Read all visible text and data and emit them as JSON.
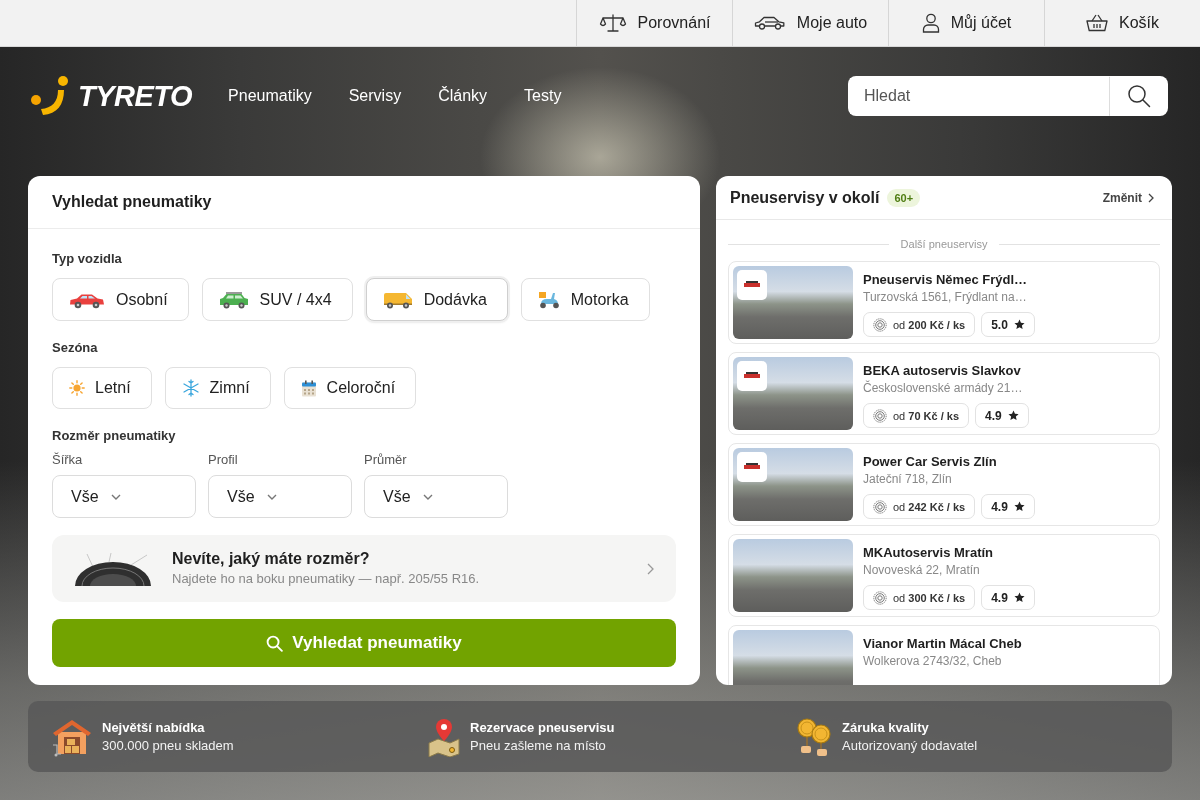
{
  "top_bar": {
    "links": [
      {
        "kind": "compare",
        "label": "Porovnání"
      },
      {
        "kind": "car",
        "label": "Moje auto"
      },
      {
        "kind": "account",
        "label": "Můj účet"
      },
      {
        "kind": "cart",
        "label": "Košík"
      }
    ]
  },
  "header": {
    "logo": "TYRETO",
    "nav": [
      "Pneumatiky",
      "Servisy",
      "Články",
      "Testy"
    ],
    "search": {
      "placeholder": "Hledat"
    }
  },
  "search_panel": {
    "title": "Vyhledat pneumatiky",
    "vehicle_type": {
      "label": "Typ vozidla",
      "options": [
        {
          "kind": "car",
          "label": "Osobní",
          "selected": false
        },
        {
          "kind": "suv",
          "label": "SUV / 4x4",
          "selected": false
        },
        {
          "kind": "van",
          "label": "Dodávka",
          "selected": true
        },
        {
          "kind": "scooter",
          "label": "Motorka",
          "selected": false
        }
      ]
    },
    "season": {
      "label": "Sezóna",
      "options": [
        {
          "kind": "summer",
          "label": "Letní",
          "selected": false
        },
        {
          "kind": "winter",
          "label": "Zimní",
          "selected": false
        },
        {
          "kind": "all_season",
          "label": "Celoroční",
          "selected": false
        }
      ]
    },
    "tire_size": {
      "label": "Rozměr pneumatiky",
      "fields": [
        {
          "label": "Šířka",
          "value": "Vše"
        },
        {
          "label": "Profil",
          "value": "Vše"
        },
        {
          "label": "Průměr",
          "value": "Vše"
        }
      ]
    },
    "size_hint": {
      "title": "Nevíte, jaký máte rozměr?",
      "text": "Najdete ho na boku pneumatiky — např. 205/55 R16."
    },
    "submit": "Vyhledat pneumatiky"
  },
  "services": {
    "title": "Pneuservisy v okolí",
    "count": "60+",
    "change_link": "Změnit",
    "divider": "Další pneuservisy",
    "items": [
      {
        "name": "Pneuservis Němec Frýdl…",
        "address": "Turzovská 1561, Frýdlant na…",
        "price": "od **200 Kč / ks**",
        "rating": "5.0",
        "logo_badge": true
      },
      {
        "name": "BEKA autoservis Slavkov",
        "address": "Československé armády 21…",
        "price": "od **70 Kč / ks**",
        "rating": "4.9",
        "logo_badge": true
      },
      {
        "name": "Power Car Servis Zlín",
        "address": "Jateční 718, Zlín",
        "price": "od **242 Kč / ks**",
        "rating": "4.9",
        "logo_badge": true
      },
      {
        "name": "MKAutoservis Mratín",
        "address": "Novoveská 22, Mratín",
        "price": "od **300 Kč / ks**",
        "rating": "4.9",
        "logo_badge": false
      },
      {
        "name": "Vianor Martin Mácal Cheb",
        "address": "Wolkerova 2743/32, Cheb",
        "logo_badge": false
      }
    ]
  },
  "features": [
    {
      "kind": "warehouse",
      "title": "Největší nabídka",
      "text": "300.000 pneu skladem"
    },
    {
      "kind": "map_pin",
      "title": "Rezervace pneuservisu",
      "text": "Pneu zašleme na místo"
    },
    {
      "kind": "quality",
      "title": "Záruka kvality",
      "text": "Autorizovaný dodavatel"
    }
  ]
}
